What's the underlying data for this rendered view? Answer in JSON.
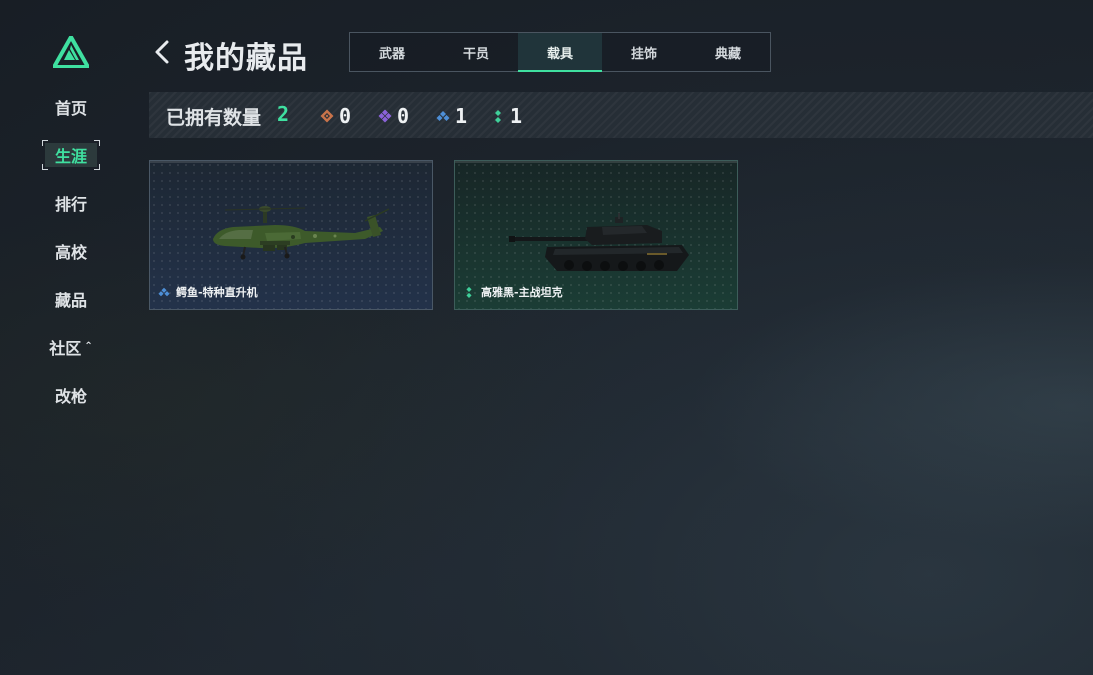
{
  "sidebar": {
    "items": [
      {
        "label": "首页"
      },
      {
        "label": "生涯"
      },
      {
        "label": "排行"
      },
      {
        "label": "高校"
      },
      {
        "label": "藏品"
      },
      {
        "label": "社区",
        "caret": "⌃"
      },
      {
        "label": "改枪"
      }
    ],
    "active": "生涯"
  },
  "header": {
    "title": "我的藏品",
    "tabs": [
      {
        "label": "武器"
      },
      {
        "label": "干员"
      },
      {
        "label": "载具"
      },
      {
        "label": "挂饰"
      },
      {
        "label": "典藏"
      }
    ],
    "active_tab": "载具"
  },
  "stats": {
    "label": "已拥有数量",
    "total": "2",
    "by_rarity": [
      {
        "icon": "orange-diamond-icon",
        "color": "#c8734a",
        "value": "0"
      },
      {
        "icon": "purple-diamond-icon",
        "color": "#8a62d8",
        "value": "0"
      },
      {
        "icon": "blue-rank-icon",
        "color": "#4d8ed6",
        "value": "1"
      },
      {
        "icon": "green-rank-icon",
        "color": "#3fd09a",
        "value": "1"
      }
    ]
  },
  "items": [
    {
      "name": "鳄鱼-特种直升机",
      "rarity_icon": "blue-rank-icon"
    },
    {
      "name": "高雅黑-主战坦克",
      "rarity_icon": "green-rank-icon"
    }
  ],
  "colors": {
    "accent": "#3fe0a0",
    "background": "#1c232b"
  }
}
